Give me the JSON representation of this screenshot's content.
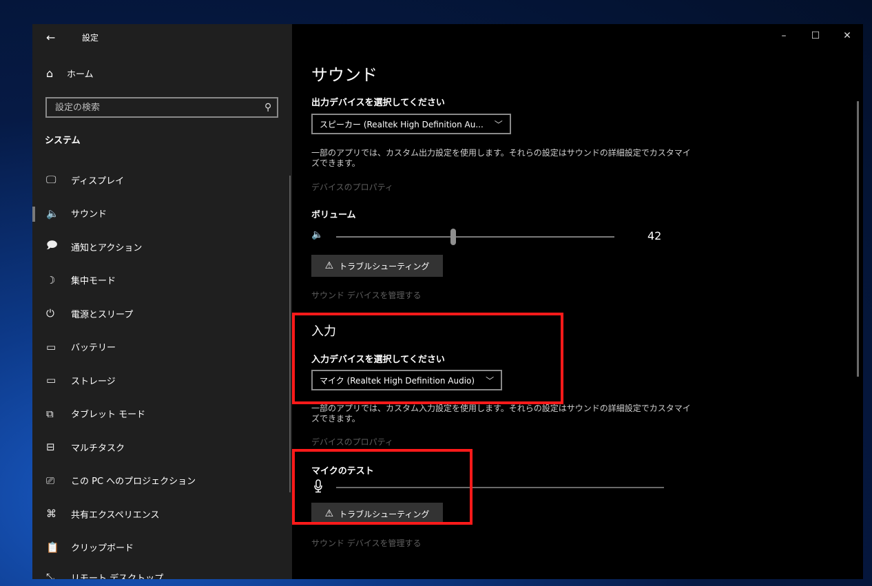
{
  "window": {
    "app_title": "設定",
    "controls": {
      "minimize": "–",
      "maximize": "☐",
      "close": "✕"
    }
  },
  "sidebar": {
    "home": "ホーム",
    "search": {
      "value": "",
      "placeholder": "設定の検索"
    },
    "section_title": "システム",
    "items": [
      {
        "label": "ディスプレイ",
        "icon": "display-icon",
        "glyph": "🖵"
      },
      {
        "label": "サウンド",
        "icon": "speaker-icon",
        "glyph": "🔈"
      },
      {
        "label": "通知とアクション",
        "icon": "notification-icon",
        "glyph": "🗩"
      },
      {
        "label": "集中モード",
        "icon": "moon-icon",
        "glyph": "☽"
      },
      {
        "label": "電源とスリープ",
        "icon": "power-icon",
        "glyph": "⏻"
      },
      {
        "label": "バッテリー",
        "icon": "battery-icon",
        "glyph": "▭"
      },
      {
        "label": "ストレージ",
        "icon": "storage-icon",
        "glyph": "▭"
      },
      {
        "label": "タブレット モード",
        "icon": "tablet-mode-icon",
        "glyph": "⧉"
      },
      {
        "label": "マルチタスク",
        "icon": "multitask-icon",
        "glyph": "⊟"
      },
      {
        "label": "この PC へのプロジェクション",
        "icon": "projection-icon",
        "glyph": "⎚"
      },
      {
        "label": "共有エクスペリエンス",
        "icon": "shared-experience-icon",
        "glyph": "⌘"
      },
      {
        "label": "クリップボード",
        "icon": "clipboard-icon",
        "glyph": "📋"
      },
      {
        "label": "リモート デスクトップ",
        "icon": "remote-desktop-icon",
        "glyph": "⤡"
      }
    ],
    "active_index": 1
  },
  "main": {
    "title": "サウンド",
    "output": {
      "label": "出力デバイスを選択してください",
      "selected": "スピーカー (Realtek High Definition Au...",
      "description": "一部のアプリでは、カスタム出力設定を使用します。それらの設定はサウンドの詳細設定でカスタマイズできます。",
      "properties_link": "デバイスのプロパティ",
      "volume_label": "ボリューム",
      "volume_value": "42",
      "volume_level": 0.42,
      "troubleshoot": "トラブルシューティング",
      "manage_link": "サウンド デバイスを管理する"
    },
    "input": {
      "heading": "入力",
      "label": "入力デバイスを選択してください",
      "selected": "マイク (Realtek High Definition Audio)",
      "description": "一部のアプリでは、カスタム入力設定を使用します。それらの設定はサウンドの詳細設定でカスタマイズできます。",
      "properties_link": "デバイスのプロパティ",
      "mic_test_label": "マイクのテスト",
      "troubleshoot": "トラブルシューティング",
      "manage_link": "サウンド デバイスを管理する"
    }
  },
  "colors": {
    "highlight": "#ff1a1a",
    "sidebar_bg": "#1f1f1f",
    "content_bg": "#000000"
  }
}
